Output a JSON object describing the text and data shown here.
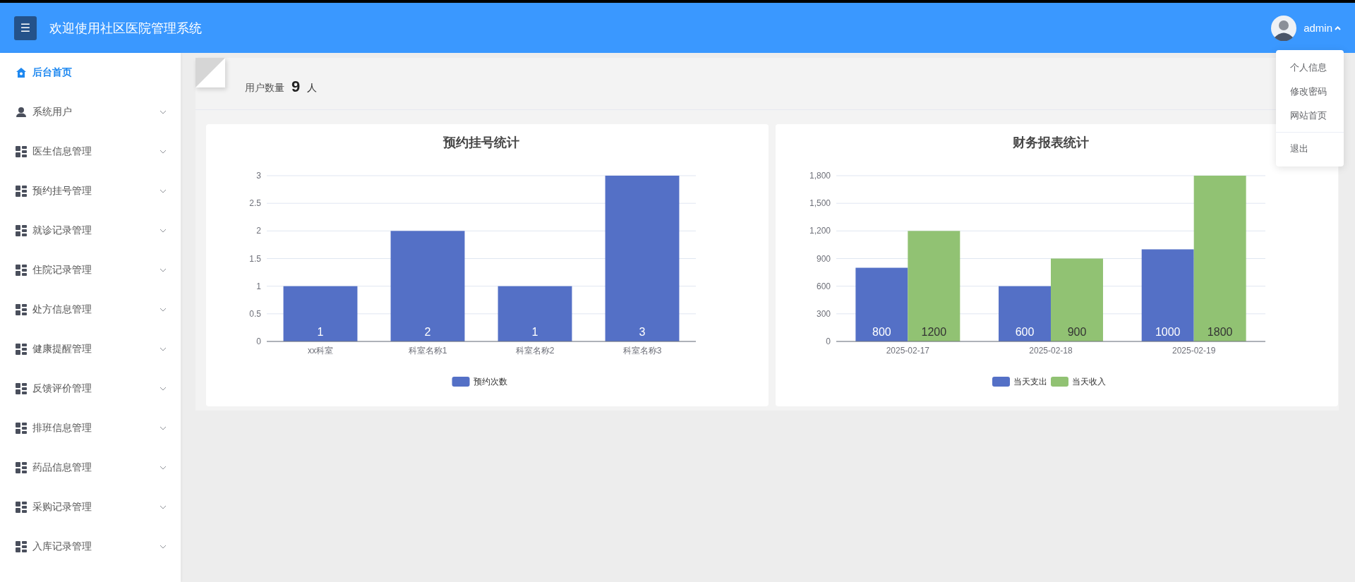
{
  "header": {
    "title": "欢迎使用社区医院管理系统",
    "menu_button": "☰",
    "user": {
      "name": "admin",
      "menu_open": true
    }
  },
  "user_menu": [
    {
      "label": "个人信息",
      "divider_before": false
    },
    {
      "label": "修改密码",
      "divider_before": false
    },
    {
      "label": "网站首页",
      "divider_before": false
    },
    {
      "label": "退出",
      "divider_before": true
    }
  ],
  "sidebar": {
    "items": [
      {
        "label": "后台首页",
        "kind": "home",
        "selected": true
      },
      {
        "label": "系统用户",
        "kind": "user",
        "selected": false,
        "expanded": false
      },
      {
        "label": "医生信息管理",
        "kind": "module",
        "selected": false,
        "expanded": false
      },
      {
        "label": "预约挂号管理",
        "kind": "module",
        "selected": false,
        "expanded": false
      },
      {
        "label": "就诊记录管理",
        "kind": "module",
        "selected": false,
        "expanded": false
      },
      {
        "label": "住院记录管理",
        "kind": "module",
        "selected": false,
        "expanded": false
      },
      {
        "label": "处方信息管理",
        "kind": "module",
        "selected": false,
        "expanded": false
      },
      {
        "label": "健康提醒管理",
        "kind": "module",
        "selected": false,
        "expanded": false
      },
      {
        "label": "反馈评价管理",
        "kind": "module",
        "selected": false,
        "expanded": false
      },
      {
        "label": "排班信息管理",
        "kind": "module",
        "selected": false,
        "expanded": false
      },
      {
        "label": "药品信息管理",
        "kind": "module",
        "selected": false,
        "expanded": false
      },
      {
        "label": "采购记录管理",
        "kind": "module",
        "selected": false,
        "expanded": false
      },
      {
        "label": "入库记录管理",
        "kind": "module",
        "selected": false,
        "expanded": false
      }
    ]
  },
  "stat": {
    "label": "用户数量",
    "value": "9",
    "unit": "人"
  },
  "charts": [
    {
      "chart_data": {
        "type": "bar",
        "title": "预约挂号统计",
        "categories": [
          "xx科室",
          "科室名称1",
          "科室名称2",
          "科室名称3"
        ],
        "series": [
          {
            "name": "预约次数",
            "color": "#5470c6",
            "values": [
              1,
              2,
              1,
              3
            ]
          }
        ],
        "ylim": [
          0,
          3
        ],
        "yticks": [
          0,
          0.5,
          1,
          1.5,
          2,
          2.5,
          3
        ],
        "data_labels": true,
        "grid": true,
        "legend": true
      }
    },
    {
      "chart_data": {
        "type": "bar",
        "title": "财务报表统计",
        "categories": [
          "2025-02-17",
          "2025-02-18",
          "2025-02-19"
        ],
        "series": [
          {
            "name": "当天支出",
            "color": "#5470c6",
            "values": [
              800,
              600,
              1000
            ]
          },
          {
            "name": "当天收入",
            "color": "#91c273",
            "values": [
              1200,
              900,
              1800
            ]
          }
        ],
        "ylim": [
          0,
          1800
        ],
        "yticks": [
          0,
          300,
          600,
          900,
          {
            "value": 1200,
            "label": "1,200"
          },
          {
            "value": 1500,
            "label": "1,500"
          },
          {
            "value": 1800,
            "label": "1,800"
          }
        ],
        "data_labels": true,
        "grid": true,
        "legend": true
      }
    }
  ]
}
